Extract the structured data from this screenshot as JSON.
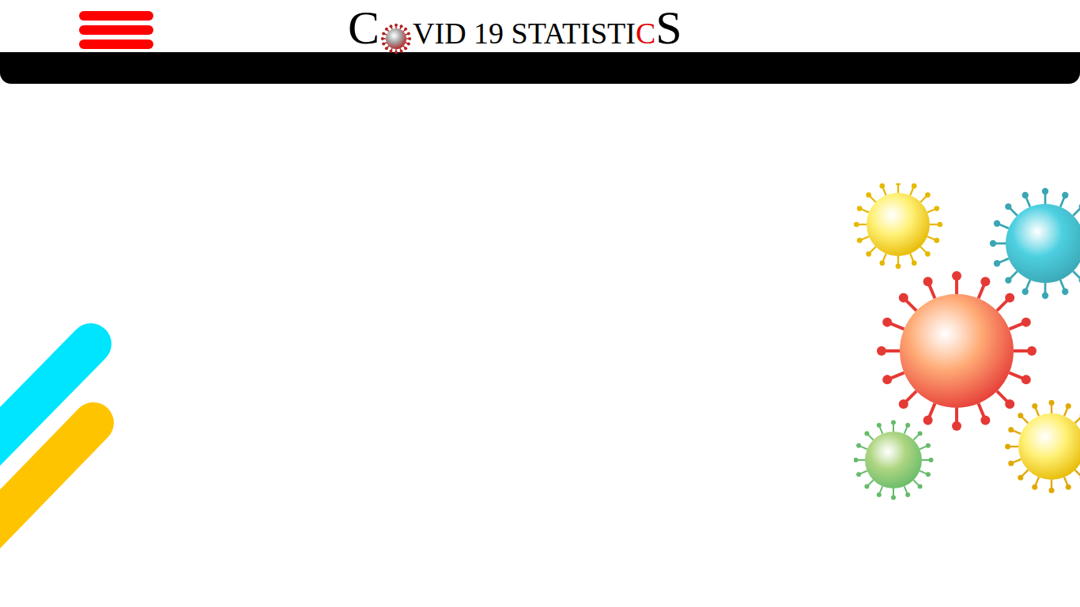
{
  "header": {
    "logo": {
      "parts": [
        {
          "kind": "text",
          "text": "C",
          "accent": false,
          "large": true
        },
        {
          "kind": "icon"
        },
        {
          "kind": "text",
          "text": "VID 19 STATISTI",
          "accent": false,
          "large": false
        },
        {
          "kind": "text",
          "text": "C",
          "accent": true,
          "large": false
        },
        {
          "kind": "text",
          "text": "S",
          "accent": false,
          "large": true
        }
      ]
    }
  }
}
